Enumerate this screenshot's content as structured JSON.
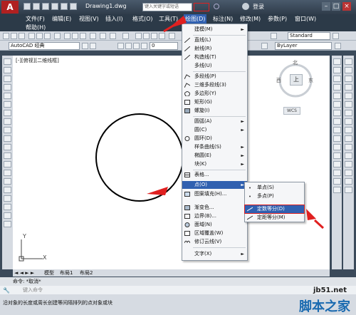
{
  "window": {
    "doc_title": "Drawing1.dwg",
    "search_placeholder": "键入关键字或短语",
    "login": "登录",
    "min": "–",
    "max": "□",
    "close": "×"
  },
  "menubar": {
    "items": [
      "文件(F)",
      "编辑(E)",
      "视图(V)",
      "插入(I)",
      "格式(O)",
      "工具(T)",
      "绘图(D)",
      "标注(N)",
      "修改(M)",
      "参数(P)",
      "窗口(W)"
    ],
    "help": "帮助(H)"
  },
  "toolbar": {
    "workspace": "AutoCAD 经典",
    "layer_value": "0",
    "style": "Standard",
    "bylayer": "ByLayer"
  },
  "viewport": {
    "label": "[-][俯视][二维线框]",
    "cube_north": "北",
    "cube_west": "西",
    "cube_east": "东",
    "cube_top": "上",
    "wcs": "WCS",
    "ucs_x": "X",
    "ucs_y": "Y"
  },
  "draw_menu": {
    "items": [
      {
        "label": "建模(M)",
        "arrow": true
      },
      {
        "label": "直线(L)",
        "arrow": false
      },
      {
        "label": "射线(R)",
        "arrow": false
      },
      {
        "label": "构造线(T)",
        "arrow": false
      },
      {
        "label": "多线(U)",
        "arrow": false
      },
      {
        "label": "多段线(P)",
        "arrow": false
      },
      {
        "label": "三维多段线(3)",
        "arrow": false
      },
      {
        "label": "多边形(Y)",
        "arrow": false
      },
      {
        "label": "矩形(G)",
        "arrow": false
      },
      {
        "label": "螺旋(I)",
        "arrow": false
      },
      {
        "label": "圆弧(A)",
        "arrow": true
      },
      {
        "label": "圆(C)",
        "arrow": true
      },
      {
        "label": "圆环(D)",
        "arrow": false
      },
      {
        "label": "样条曲线(S)",
        "arrow": true
      },
      {
        "label": "椭圆(E)",
        "arrow": true
      },
      {
        "label": "块(K)",
        "arrow": true
      },
      {
        "label": "表格...",
        "arrow": false
      },
      {
        "label": "点(O)",
        "arrow": true
      },
      {
        "label": "图案填充(H)...",
        "arrow": false
      },
      {
        "label": "渐变色...",
        "arrow": false
      },
      {
        "label": "边界(B)...",
        "arrow": false
      },
      {
        "label": "面域(N)",
        "arrow": false
      },
      {
        "label": "区域覆盖(W)",
        "arrow": false
      },
      {
        "label": "修订云线(V)",
        "arrow": false
      },
      {
        "label": "文字(X)",
        "arrow": true
      }
    ]
  },
  "point_menu": {
    "items": [
      "单点(S)",
      "多点(P)",
      "定数等分(D)",
      "定距等分(M)"
    ]
  },
  "tabs": [
    "模型",
    "布局1",
    "布局2"
  ],
  "command": {
    "line1": "命令:  *取消*",
    "line2": "键入命令",
    "status": "沿对象的长度或周长创建等间隔排列的点对象或块"
  },
  "watermark": {
    "site": "jb51.net",
    "name": "脚本之家"
  },
  "colors": {
    "highlight": "#3060b0",
    "arrow": "#e02020"
  }
}
